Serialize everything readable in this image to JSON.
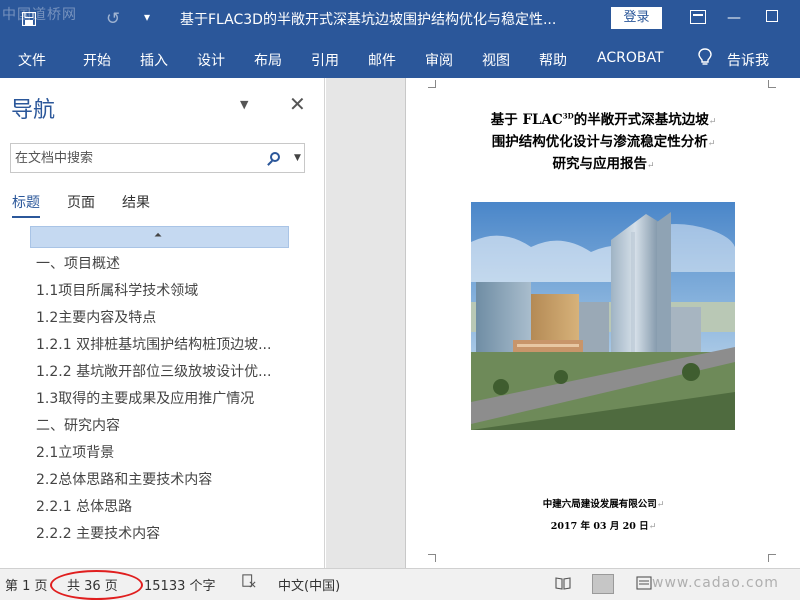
{
  "titlebar": {
    "watermark": "中国道桥网",
    "document_title": "基于FLAC3D的半敞开式深基坑边坡围护结构优化与稳定性...",
    "login_label": "登录",
    "quick_access_label": "▾"
  },
  "ribbon": {
    "tabs": [
      "文件",
      "开始",
      "插入",
      "设计",
      "布局",
      "引用",
      "邮件",
      "审阅",
      "视图",
      "帮助",
      "ACROBAT"
    ],
    "tell_me": "告诉我"
  },
  "nav": {
    "title": "导航",
    "search_placeholder": "在文档中搜索",
    "subtabs": [
      "标题",
      "页面",
      "结果"
    ],
    "headings": [
      "一、项目概述",
      "1.1项目所属科学技术领域",
      "1.2主要内容及特点",
      "1.2.1 双排桩基坑围护结构桩顶边坡...",
      "1.2.2 基坑敞开部位三级放坡设计优...",
      "1.3取得的主要成果及应用推广情况",
      "二、研究内容",
      "2.1立项背景",
      "2.2总体思路和主要技术内容",
      "2.2.1 总体思路",
      "2.2.2 主要技术内容"
    ]
  },
  "document": {
    "title_line1_prefix": "基于 FLAC",
    "title_line1_sup": "3D",
    "title_line1_suffix": "的半敞开式深基坑边坡",
    "title_line2": "围护结构优化设计与渗流稳定性分析",
    "title_line3": "研究与应用报告",
    "company": "中建六局建设发展有限公司",
    "date": "2017 年 03 月 20 日"
  },
  "statusbar": {
    "page": "第 1 页",
    "page_count": "共 36 页",
    "word_count": "15133 个字",
    "language": "中文(中国)",
    "watermark": "www.cadao.com"
  },
  "colors": {
    "brand": "#2b579a",
    "highlight_ring": "#e01e1e"
  }
}
